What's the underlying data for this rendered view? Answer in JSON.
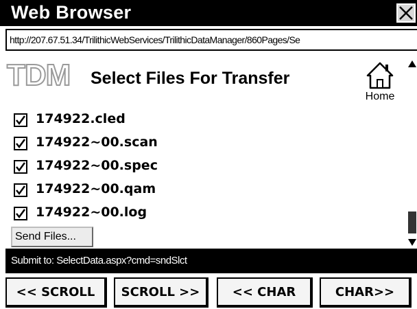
{
  "window": {
    "title": "Web Browser"
  },
  "address_bar": {
    "url": "http://207.67.51.34/TrilithicWebServices/TrilithicDataManager/860Pages/Se"
  },
  "page": {
    "logo_text": "TDM",
    "title": "Select Files For Transfer",
    "home_label": "Home",
    "files": [
      {
        "name": "174922.cled",
        "checked": true
      },
      {
        "name": "174922~00.scan",
        "checked": true
      },
      {
        "name": "174922~00.spec",
        "checked": true
      },
      {
        "name": "174922~00.qam",
        "checked": true
      },
      {
        "name": "174922~00.log",
        "checked": true
      }
    ],
    "send_button_label": "Send Files..."
  },
  "status": {
    "text": "Submit to: SelectData.aspx?cmd=sndSlct"
  },
  "nav_buttons": {
    "scroll_left": "<< SCROLL",
    "scroll_right": "SCROLL >>",
    "char_left": "<< CHAR",
    "char_right": "CHAR>>"
  }
}
